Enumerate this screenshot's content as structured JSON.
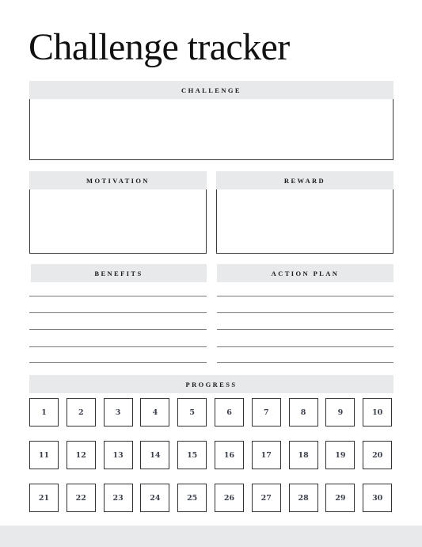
{
  "title": "Challenge tracker",
  "sections": {
    "challenge": {
      "label": "CHALLENGE"
    },
    "motivation": {
      "label": "MOTIVATION"
    },
    "reward": {
      "label": "REWARD"
    },
    "benefits": {
      "label": "BENEFITS",
      "line_count": 5
    },
    "action_plan": {
      "label": "ACTION PLAN",
      "line_count": 5
    },
    "progress": {
      "label": "PROGRESS",
      "days": [
        "1",
        "2",
        "3",
        "4",
        "5",
        "6",
        "7",
        "8",
        "9",
        "10",
        "11",
        "12",
        "13",
        "14",
        "15",
        "16",
        "17",
        "18",
        "19",
        "20",
        "21",
        "22",
        "23",
        "24",
        "25",
        "26",
        "27",
        "28",
        "29",
        "30"
      ]
    }
  },
  "colors": {
    "header_band": "#e8e9eb",
    "border": "#333333",
    "day_number": "#3b404c"
  }
}
